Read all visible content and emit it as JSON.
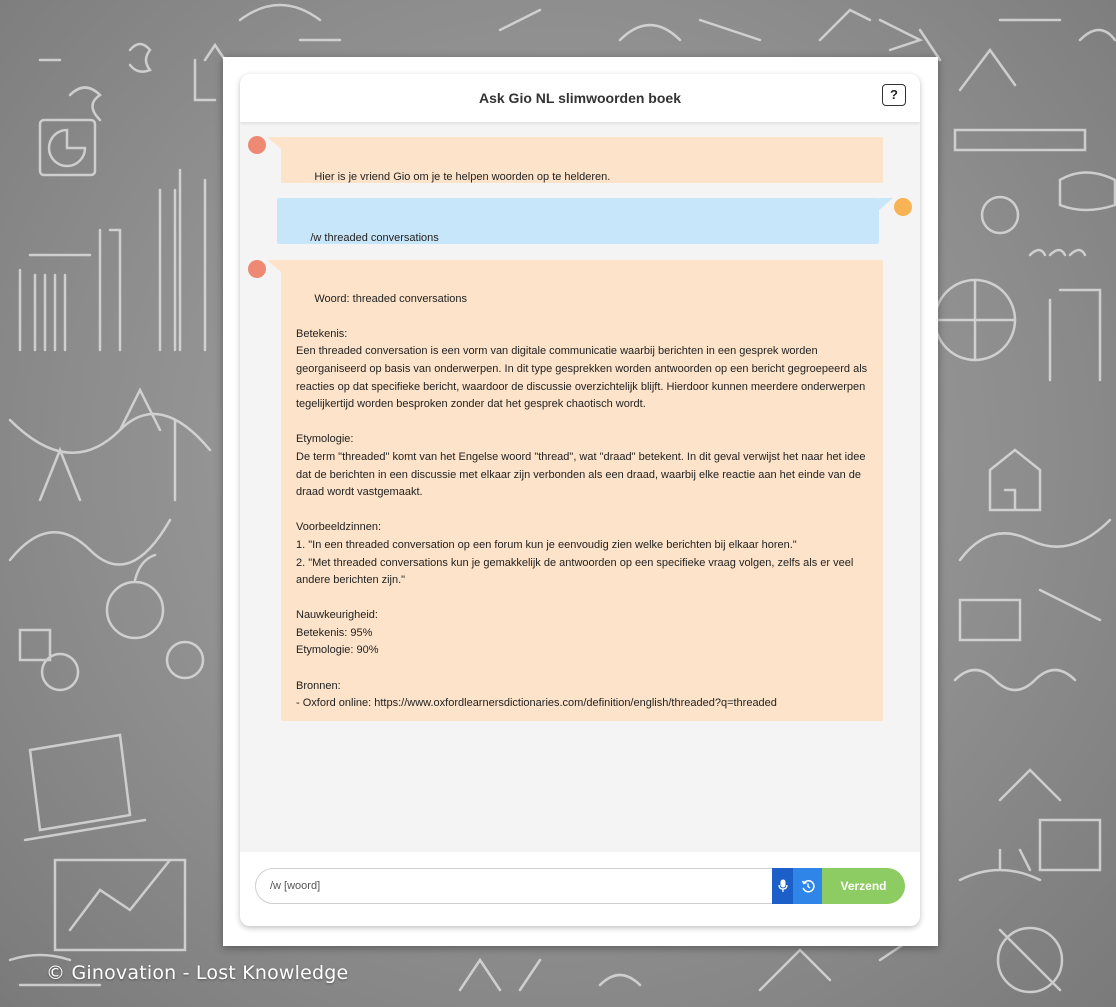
{
  "app": {
    "title": "Ask Gio NL slimwoorden boek",
    "help_label": "?"
  },
  "background": {
    "copyright": "© Ginovation - Lost Knowledge"
  },
  "messages": [
    {
      "role": "bot",
      "text": "Hier is je vriend Gio om je te helpen woorden op te helderen."
    },
    {
      "role": "user",
      "text": "/w threaded conversations"
    },
    {
      "role": "bot",
      "text": "Woord: threaded conversations\n\nBetekenis:\nEen threaded conversation is een vorm van digitale communicatie waarbij berichten in een gesprek worden\ngeorganiseerd op basis van onderwerpen. In dit type gesprekken worden antwoorden op een bericht gegroepeerd als\nreacties op dat specifieke bericht, waardoor de discussie overzichtelijk blijft. Hierdoor kunnen meerdere onderwerpen\ntegelijkertijd worden besproken zonder dat het gesprek chaotisch wordt.\n\nEtymologie:\nDe term \"threaded\" komt van het Engelse woord \"thread\", wat \"draad\" betekent. In dit geval verwijst het naar het idee\ndat de berichten in een discussie met elkaar zijn verbonden als een draad, waarbij elke reactie aan het einde van de\ndraad wordt vastgemaakt.\n\nVoorbeeldzinnen:\n1. \"In een threaded conversation op een forum kun je eenvoudig zien welke berichten bij elkaar horen.\"\n2. \"Met threaded conversations kun je gemakkelijk de antwoorden op een specifieke vraag volgen, zelfs als er veel\nandere berichten zijn.\"\n\nNauwkeurigheid:\nBetekenis: 95%\nEtymologie: 90%\n\nBronnen:\n- Oxford online: https://www.oxfordlearnersdictionaries.com/definition/english/threaded?q=threaded"
    }
  ],
  "input": {
    "placeholder": "/w [woord]",
    "value": ""
  },
  "buttons": {
    "mic_icon": "microphone-icon",
    "history_icon": "history-icon",
    "send_label": "Verzend"
  },
  "colors": {
    "bot_bubble": "#fde3c9",
    "user_bubble": "#c8e6f9",
    "bot_avatar": "#ee8a74",
    "user_avatar": "#f7b354",
    "send_button": "#8dcc62",
    "mic_button": "#1c5fc8",
    "history_button": "#2f86e8"
  }
}
